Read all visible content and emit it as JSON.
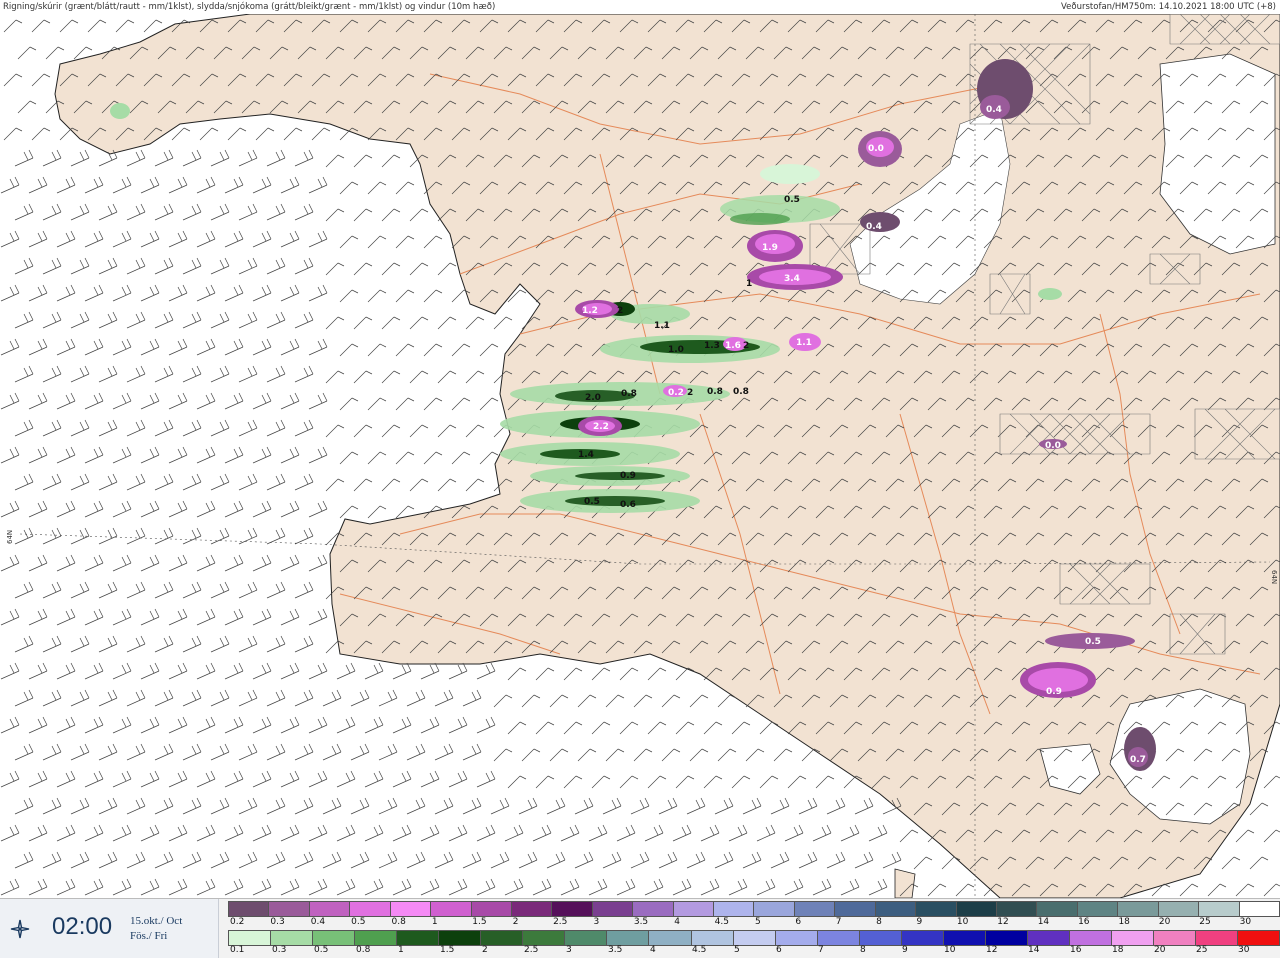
{
  "header": {
    "left": "Rigning/skúrir (grænt/blátt/rautt - mm/1klst), slydda/snjókoma (grátt/bleikt/grænt - mm/1klst) og vindur (10m hæð)",
    "right": "Veðurstofan/HM750m: 14.10.2021 18:00 UTC (+8)"
  },
  "time_panel": {
    "time": "02:00",
    "date_line1": "15.okt./ Oct",
    "date_line2": "Fös./ Fri",
    "icon": "compass-star-icon"
  },
  "latitude_label": "64N",
  "precip_labels": [
    {
      "text": "0.4",
      "kind": "snow"
    },
    {
      "text": "0.0",
      "kind": "snow"
    },
    {
      "text": "0.5",
      "kind": "rain"
    },
    {
      "text": "0.4",
      "kind": "snow"
    },
    {
      "text": "1.9",
      "kind": "snow"
    },
    {
      "text": "3.4",
      "kind": "snow"
    },
    {
      "text": "1",
      "kind": "rain"
    },
    {
      "text": "1.2",
      "kind": "snow"
    },
    {
      "text": "2",
      "kind": "rain"
    },
    {
      "text": "1.1",
      "kind": "rain"
    },
    {
      "text": "1.0",
      "kind": "rain"
    },
    {
      "text": "1.3",
      "kind": "rain"
    },
    {
      "text": "1.6",
      "kind": "snow"
    },
    {
      "text": "2",
      "kind": "rain"
    },
    {
      "text": "1.1",
      "kind": "snow"
    },
    {
      "text": "0.8",
      "kind": "rain"
    },
    {
      "text": "0.2",
      "kind": "snow"
    },
    {
      "text": "2",
      "kind": "rain"
    },
    {
      "text": "0.8",
      "kind": "rain"
    },
    {
      "text": "0.8",
      "kind": "rain"
    },
    {
      "text": "2.0",
      "kind": "rain"
    },
    {
      "text": "2.2",
      "kind": "snow"
    },
    {
      "text": "1.4",
      "kind": "rain"
    },
    {
      "text": "0.9",
      "kind": "rain"
    },
    {
      "text": "0.5",
      "kind": "rain"
    },
    {
      "text": "0.6",
      "kind": "rain"
    },
    {
      "text": "0.0",
      "kind": "snow"
    },
    {
      "text": "0.5",
      "kind": "snow"
    },
    {
      "text": "0.9",
      "kind": "snow"
    },
    {
      "text": "0.7",
      "kind": "snow"
    }
  ],
  "legend": {
    "snow_scale": {
      "labels": [
        "0.2",
        "0.3",
        "0.4",
        "0.5",
        "0.8",
        "1",
        "1.5",
        "2",
        "2.5",
        "3",
        "3.5",
        "4",
        "4.5",
        "5",
        "6",
        "7",
        "8",
        "9",
        "10",
        "12",
        "14",
        "16",
        "18",
        "20",
        "25",
        "30"
      ],
      "colors": [
        "#6e4d6e",
        "#9a5b9a",
        "#c062c0",
        "#e070e0",
        "#f58af5",
        "#d060d0",
        "#a84aa8",
        "#7a2a7a",
        "#55105a",
        "#7a3f90",
        "#9a6cc0",
        "#b39ae0",
        "#aeb4ec",
        "#9aa6dc",
        "#6f82b8",
        "#4f6a9a",
        "#3d5e80",
        "#2a4f62",
        "#1d3e48",
        "#314e52",
        "#4a6e6e",
        "#5f8484",
        "#7a9a9a",
        "#96b0b0",
        "#b8cccc",
        "#ffffff"
      ]
    },
    "rain_scale": {
      "labels": [
        "0.1",
        "0.3",
        "0.5",
        "0.8",
        "1",
        "1.5",
        "2",
        "2.5",
        "3",
        "3.5",
        "4",
        "4.5",
        "5",
        "6",
        "7",
        "8",
        "9",
        "10",
        "12",
        "14",
        "16",
        "18",
        "20",
        "25",
        "30"
      ],
      "colors": [
        "#d8f5d8",
        "#a6dca6",
        "#78c078",
        "#4f9f4f",
        "#1e5a1e",
        "#0d400d",
        "#275f27",
        "#3c7a3c",
        "#4f8a6a",
        "#6f9ea0",
        "#8fb0c4",
        "#b0c4e0",
        "#c4ccf0",
        "#a4acec",
        "#7c84e0",
        "#5460d4",
        "#3434c4",
        "#1010b0",
        "#0000a0",
        "#6030c0",
        "#c070e0",
        "#f0a0f0",
        "#f080c0",
        "#f04080",
        "#f01010"
      ]
    }
  }
}
